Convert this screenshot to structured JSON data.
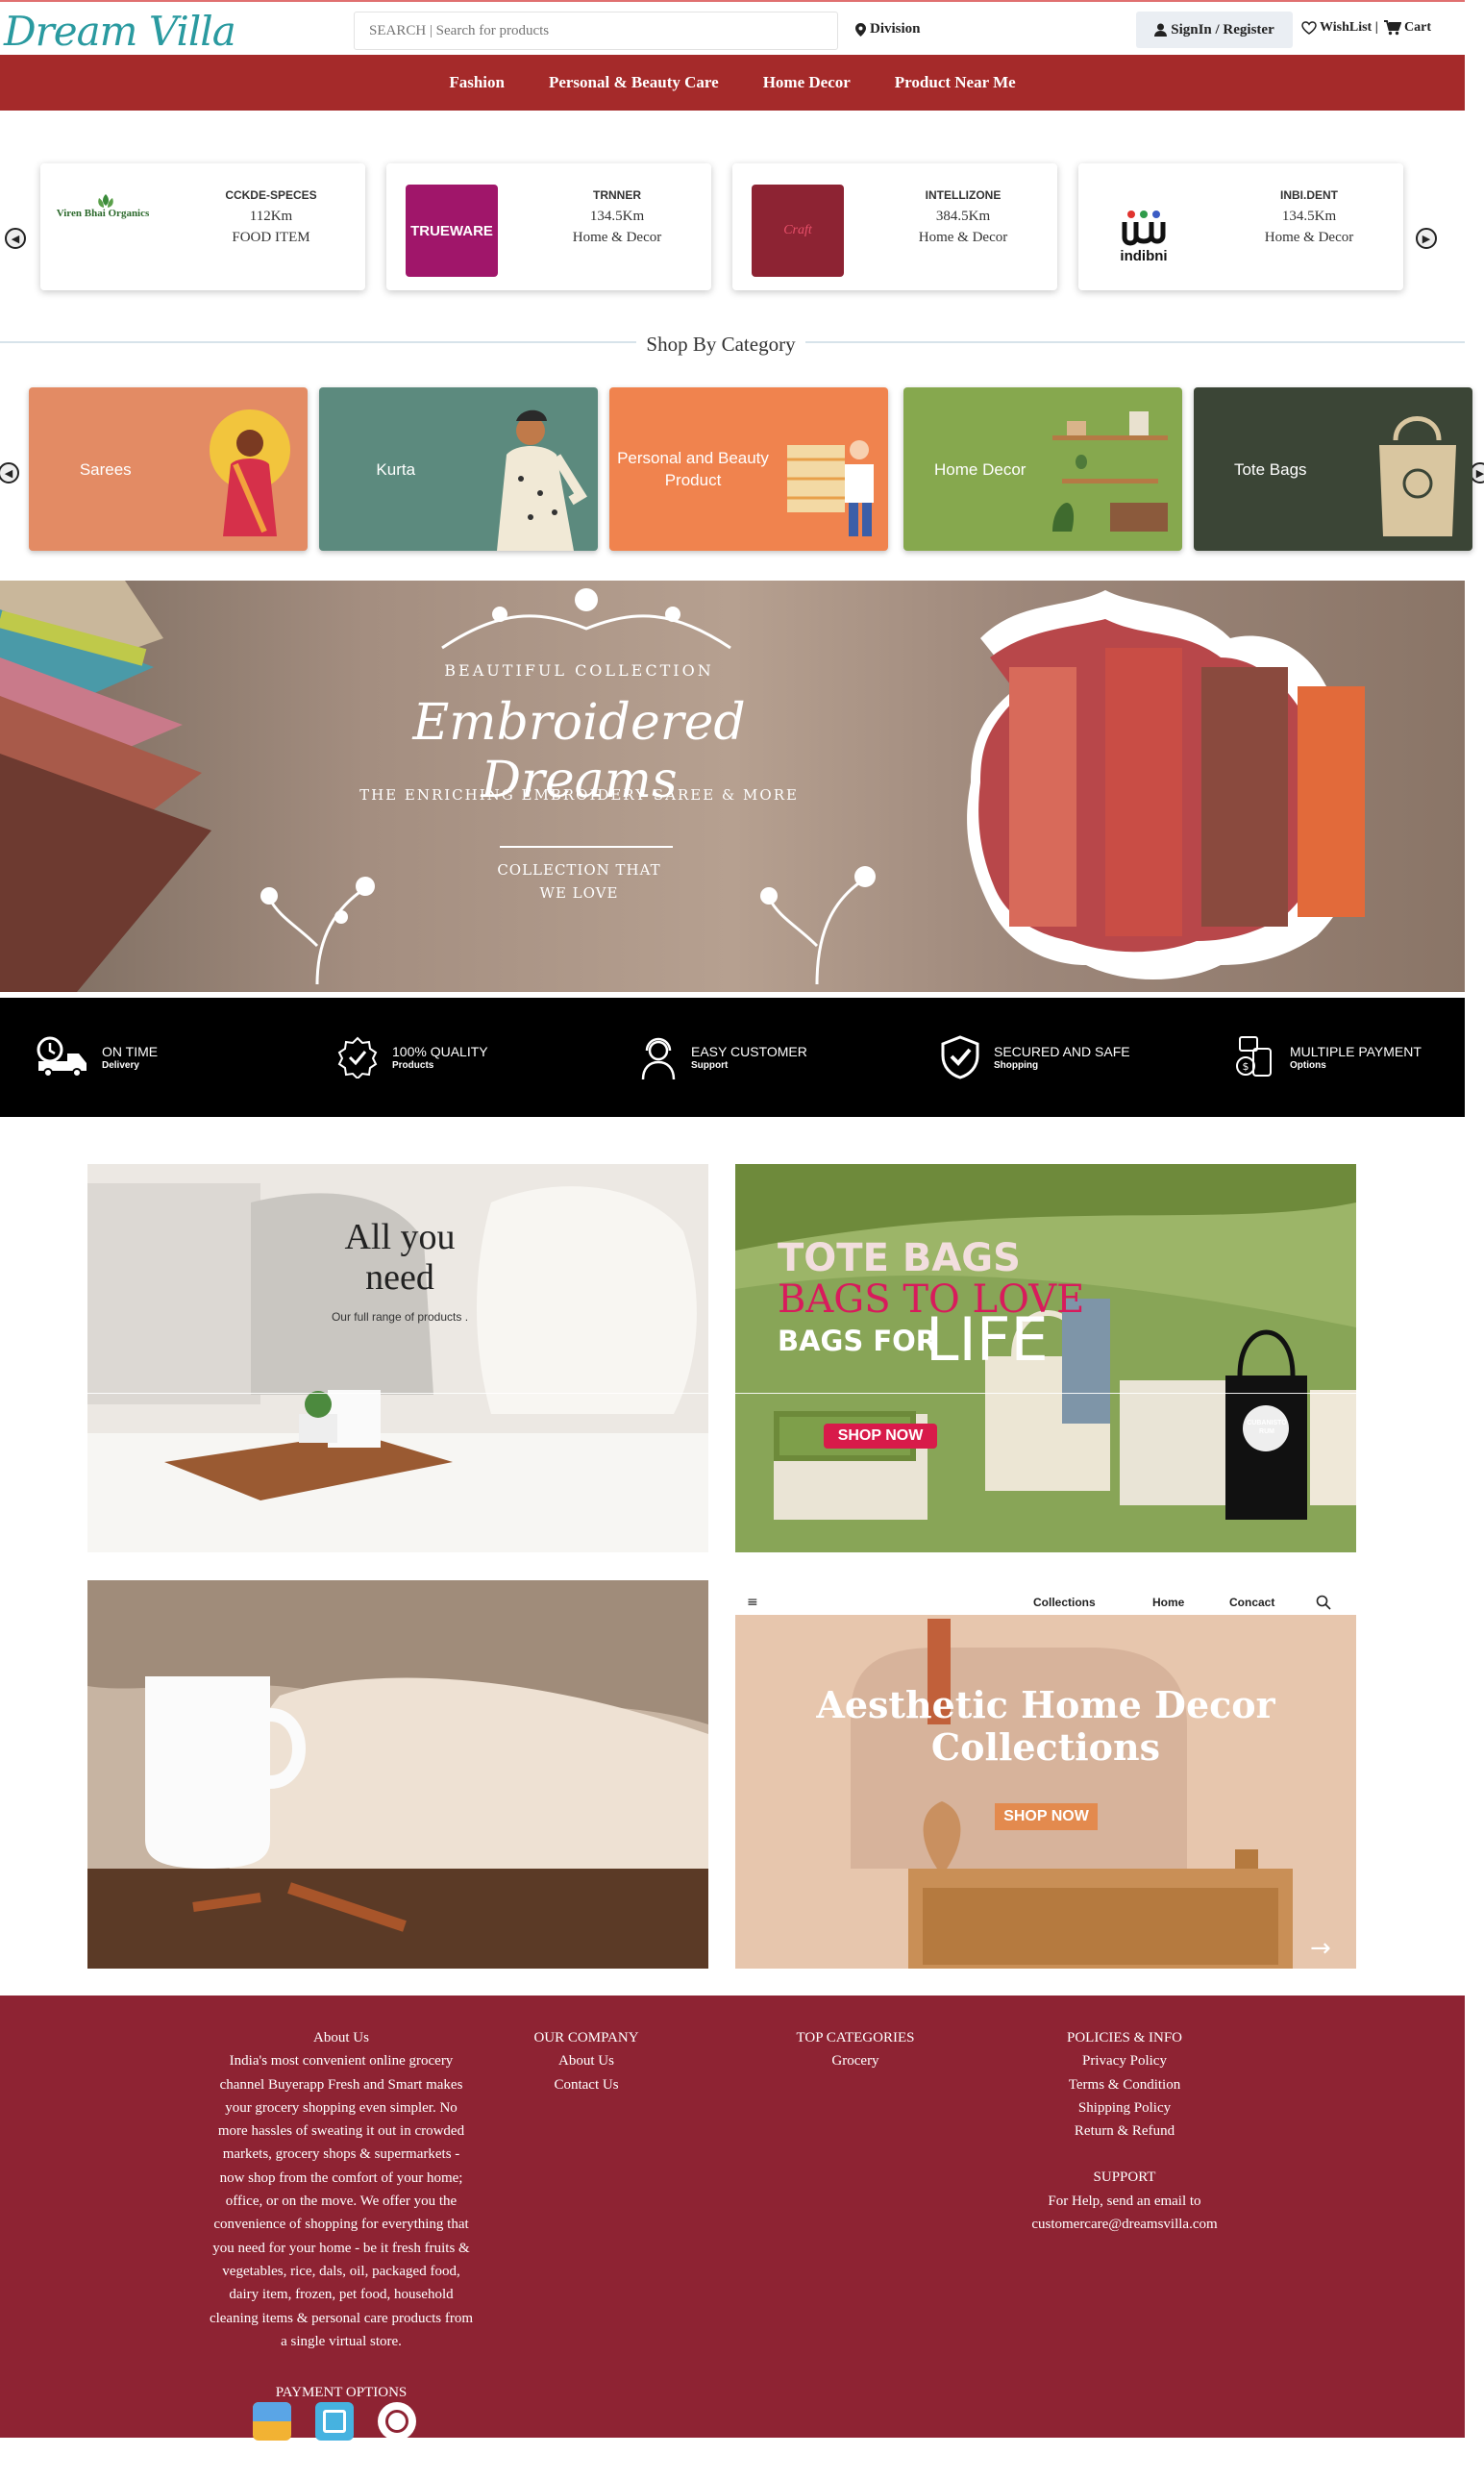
{
  "header": {
    "logo": "Dream Villa",
    "search_placeholder": "SEARCH | Search for products",
    "division": "Division",
    "signin": "SignIn / Register",
    "wishlist": "WishList |",
    "cart": "Cart"
  },
  "nav": [
    "Fashion",
    "Personal & Beauty Care",
    "Home Decor",
    "Product Near Me"
  ],
  "vendors": [
    {
      "name": "CCKDE-SPECES",
      "distance": "112Km",
      "category": "FOOD ITEM",
      "logo_text": "Viren Bhai Organics"
    },
    {
      "name": "TRNNER",
      "distance": "134.5Km",
      "category": "Home & Decor",
      "logo_text": "TRUEWARE"
    },
    {
      "name": "INTELLIZONE",
      "distance": "384.5Km",
      "category": "Home & Decor",
      "logo_text": "Craft"
    },
    {
      "name": "INBI.DENT",
      "distance": "134.5Km",
      "category": "Home & Decor",
      "logo_text": "indibni"
    }
  ],
  "section_title": "Shop By Category",
  "categories": [
    {
      "label": "Sarees",
      "color": "#e38b64"
    },
    {
      "label": "Kurta",
      "color": "#5c8a7e"
    },
    {
      "label": "Personal and Beauty Product",
      "color": "#f0834e"
    },
    {
      "label": "Home Decor",
      "color": "#86a84e"
    },
    {
      "label": "Tote Bags",
      "color": "#3b4536"
    }
  ],
  "banner": {
    "kicker": "BEAUTIFUL COLLECTION",
    "title": "Embroidered Dreams",
    "subtitle": "THE ENRICHING EMBROIDERY SAREE & MORE",
    "tagline_1": "COLLECTION THAT",
    "tagline_2": "WE LOVE"
  },
  "features": [
    {
      "title": "ON TIME",
      "sub": "Delivery",
      "icon": "delivery-truck-icon"
    },
    {
      "title": "100% QUALITY",
      "sub": "Products",
      "icon": "quality-badge-icon"
    },
    {
      "title": "EASY CUSTOMER",
      "sub": "Support",
      "icon": "support-agent-icon"
    },
    {
      "title": "SECURED AND SAFE",
      "sub": "Shopping",
      "icon": "shield-check-icon"
    },
    {
      "title": "MULTIPLE PAYMENT",
      "sub": "Options",
      "icon": "payment-icon"
    }
  ],
  "promos": {
    "all_need_title": "All you need",
    "all_need_sub": "Our full range of products .",
    "tote_1": "TOTE BAGS",
    "tote_2": "BAGS TO LOVE",
    "tote_3": "BAGS FOR",
    "tote_4": "LIFE",
    "tote_cta": "SHOP NOW",
    "tote_bag_print_1": "CUBANISTO",
    "tote_bag_print_2": "RUM",
    "decor_nav": [
      "Collections",
      "Home",
      "Concact"
    ],
    "decor_title_1": "Aesthetic Home Decor",
    "decor_title_2": "Collections",
    "decor_cta": "SHOP NOW"
  },
  "footer": {
    "about_title": "About Us",
    "about_lines": [
      "India's most convenient online grocery",
      "channel Buyerapp Fresh and Smart makes",
      "your grocery shopping even simpler. No",
      "more hassles of sweating it out in crowded",
      "markets, grocery shops & supermarkets -",
      "now shop from the comfort of your home;",
      "office, or on the move. We offer you the",
      "convenience of shopping for everything that",
      "you need for your home - be it fresh fruits &",
      "vegetables, rice, dals, oil, packaged food,",
      "dairy item, frozen, pet food, household",
      "cleaning items & personal care products from",
      "a single virtual store."
    ],
    "payment_title": "PAYMENT OPTIONS",
    "company_title": "OUR COMPANY",
    "company_links": [
      "About Us",
      "Contact Us"
    ],
    "top_cat_title": "TOP CATEGORIES",
    "top_cat_links": [
      "Grocery"
    ],
    "policies_title": "POLICIES & INFO",
    "policies_links": [
      "Privacy Policy",
      "Terms & Condition",
      "Shipping Policy",
      "Return & Refund"
    ],
    "support_title": "SUPPORT",
    "support_line": "For Help, send an email to",
    "support_email": "customercare@dreamsvilla.com"
  }
}
